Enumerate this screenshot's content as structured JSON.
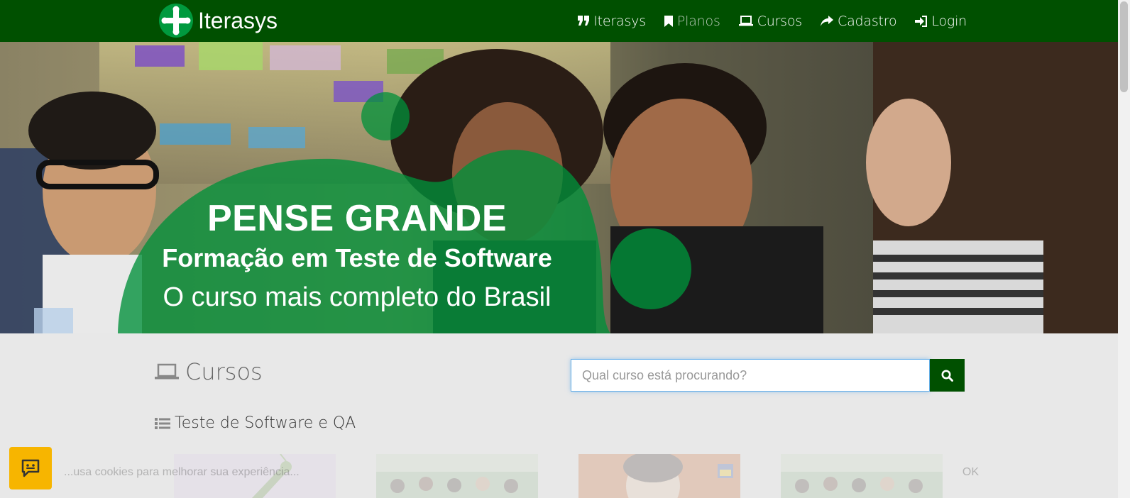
{
  "navbar": {
    "brand_name": "Iterasys",
    "items": [
      {
        "label": "Iterasys",
        "icon": "quote-icon"
      },
      {
        "label": "Planos",
        "icon": "bookmark-icon",
        "active": true
      },
      {
        "label": "Cursos",
        "icon": "laptop-icon"
      },
      {
        "label": "Cadastro",
        "icon": "share-arrow-icon"
      },
      {
        "label": "Login",
        "icon": "sign-in-icon"
      }
    ]
  },
  "hero": {
    "title": "PENSE GRANDE",
    "subtitle": "Formação em Teste de Software",
    "tagline": "O curso mais completo do Brasil"
  },
  "courses": {
    "heading": "Cursos",
    "search_placeholder": "Qual curso está procurando?",
    "category": "Teste de Software e QA"
  },
  "cookie_banner": {
    "text": "...usa cookies para melhorar sua experiência...",
    "button": "OK"
  },
  "colors": {
    "navbar": "#005000",
    "accent_green": "#00903a",
    "chat_button": "#f7b500"
  }
}
